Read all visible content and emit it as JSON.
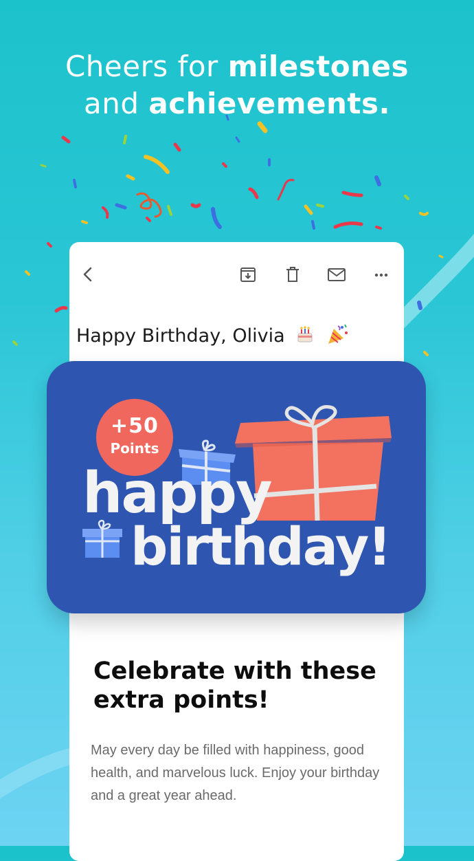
{
  "headline": {
    "line1_light": "Cheers for ",
    "line1_bold": "milestones",
    "line2_light": "and ",
    "line2_bold": "achievements."
  },
  "toolbar": {
    "icons": [
      "back-icon",
      "archive-icon",
      "delete-icon",
      "mail-icon",
      "more-icon"
    ]
  },
  "email": {
    "subject": "Happy Birthday, Olivia",
    "subject_emojis": [
      "birthday-cake-emoji",
      "party-popper-emoji"
    ]
  },
  "banner": {
    "points_value": "+50",
    "points_label": "Points",
    "line1": "happy",
    "line2": "birthday!"
  },
  "body": {
    "title": "Celebrate with these extra points!",
    "text": "May every day be filled with happiness, good health, and marvelous luck. Enjoy your birthday and a great year ahead."
  },
  "colors": {
    "background_top": "#1cc2cb",
    "background_bottom": "#6dd3f3",
    "banner": "#2e56b0",
    "points_badge": "#f0675e",
    "gift_large": "#f2715f",
    "gift_small": "#5b8ef0"
  }
}
